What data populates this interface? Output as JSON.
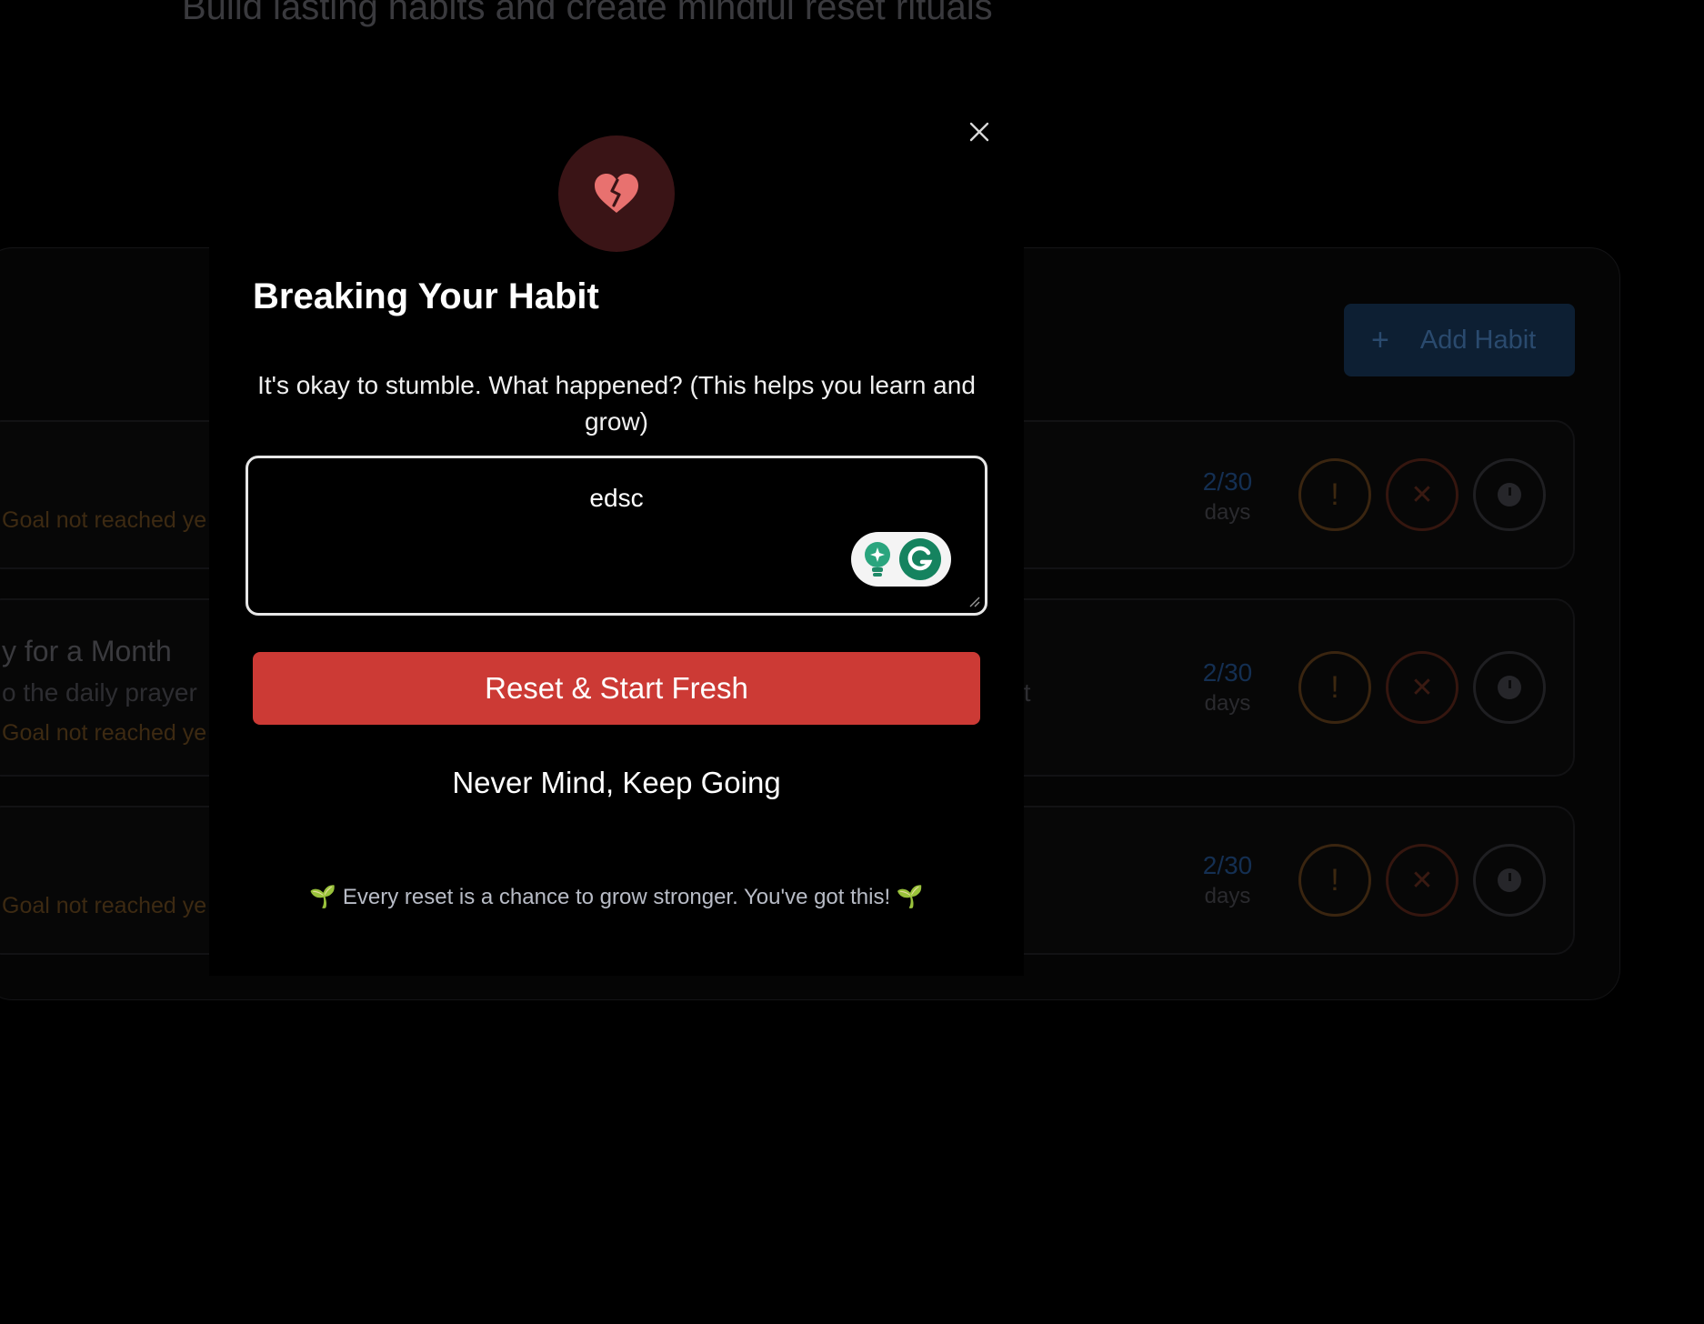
{
  "background": {
    "subtitle": "Build lasting habits and create mindful reset rituals",
    "add_habit_label": "Add Habit",
    "cards": [
      {
        "title": "",
        "description": "",
        "goal_status": "Goal not reached ye",
        "progress": "2/30",
        "unit": "days"
      },
      {
        "title": "y for a Month",
        "description": "o the daily prayer",
        "extra_text": "bit",
        "goal_status": "Goal not reached ye",
        "progress": "2/30",
        "unit": "days"
      },
      {
        "title": "",
        "description": "",
        "goal_status": "Goal not reached ye",
        "progress": "2/30",
        "unit": "days"
      }
    ],
    "action_glyphs": {
      "warn": "!",
      "reset": "✕"
    }
  },
  "modal": {
    "title": "Breaking Your Habit",
    "prompt": "It's okay to stumble. What happened? (This helps you learn and grow)",
    "input_value": "edsc",
    "reset_label": "Reset & Start Fresh",
    "keep_label": "Never Mind, Keep Going",
    "encouragement": "Every reset is a chance to grow stronger. You've got this!",
    "sprout_glyph": "🌱",
    "icon": "broken-heart-icon"
  },
  "colors": {
    "accent_red": "#cc3a35",
    "icon_bg": "#3a1416",
    "heart": "#e8716f"
  }
}
